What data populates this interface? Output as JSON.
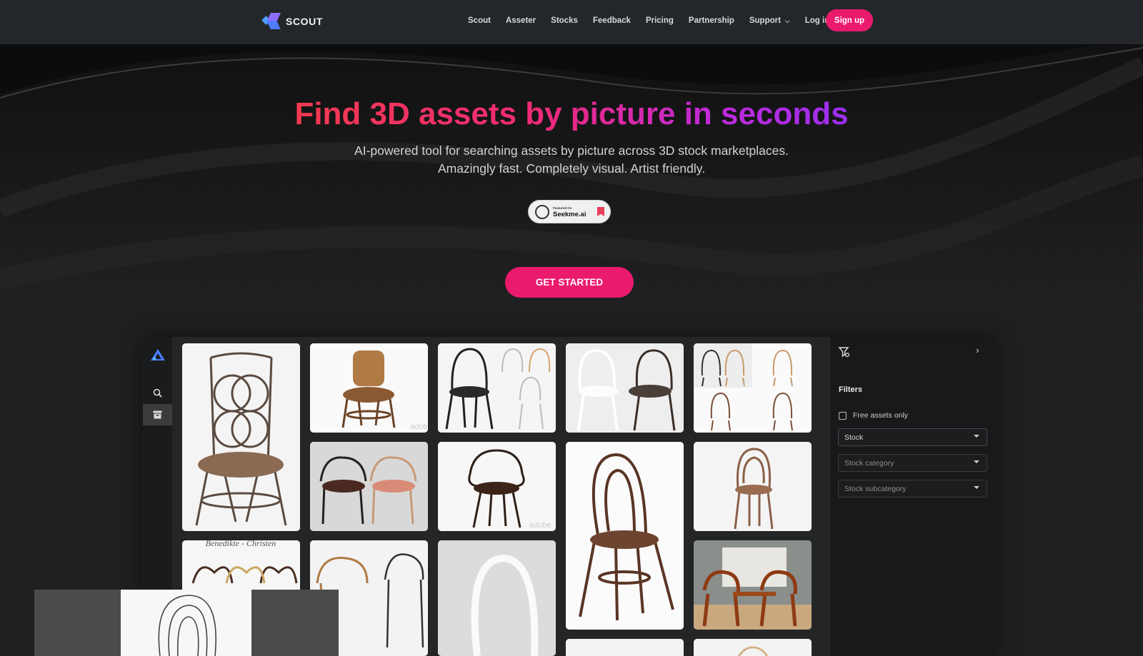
{
  "nav": {
    "logo_text": "SCOUT",
    "links": [
      "Scout",
      "Asseter",
      "Stocks",
      "Feedback",
      "Pricing",
      "Partnership",
      "Support",
      "Log in"
    ],
    "signup_label": "Sign up"
  },
  "hero": {
    "title": "Find 3D assets by picture in seconds",
    "subtitle_line1": "AI-powered tool for searching assets by picture across 3D stock marketplaces.",
    "subtitle_line2": "Amazingly fast. Completely visual. Artist friendly.",
    "badge": {
      "small_text": "Featured On",
      "name": "Seekme.ai"
    },
    "cta_label": "GET STARTED"
  },
  "app": {
    "sidebar_icons": [
      "app-logo-icon",
      "search-icon",
      "archive-icon"
    ],
    "filters": {
      "title": "Filters",
      "free_assets_label": "Free assets only",
      "selects": [
        "Stock",
        "Stock category",
        "Stock subcategory"
      ]
    },
    "watermarks": [
      "adobe",
      "adobe"
    ],
    "tile_caption": "Benedikte - Christen"
  },
  "colors": {
    "accent": "#ea1a6d",
    "nav_bg": "#24272a",
    "page_bg": "#1f2021"
  }
}
